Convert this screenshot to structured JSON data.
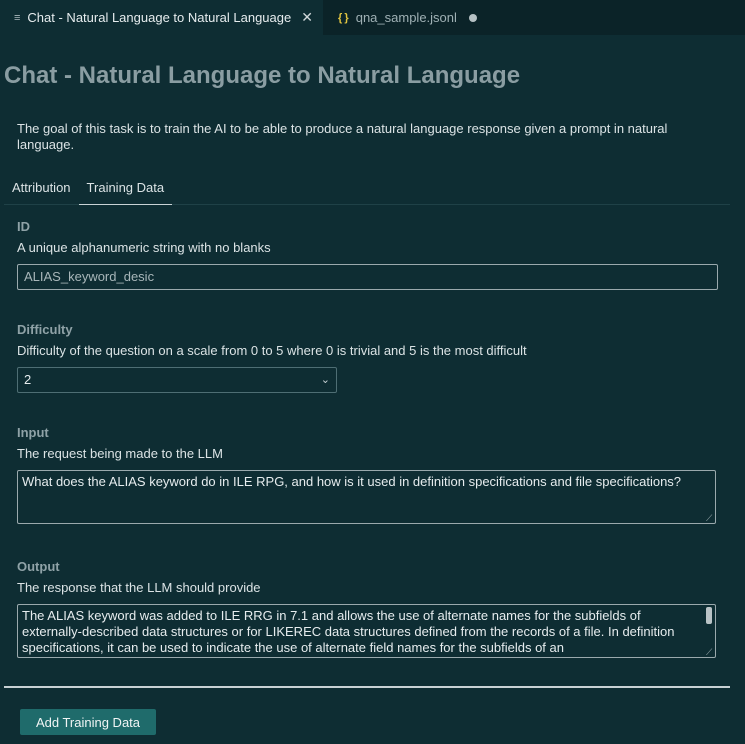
{
  "tabs": [
    {
      "icon": "lines-icon",
      "label": "Chat - Natural Language to Natural Language",
      "active": true
    },
    {
      "icon": "json-braces-icon",
      "label": "qna_sample.jsonl",
      "active": false,
      "modified": true
    }
  ],
  "page": {
    "title": "Chat - Natural Language to Natural Language",
    "description": "The goal of this task is to train the AI to be able to produce a natural language response given a prompt in natural language."
  },
  "subtabs": [
    "Attribution",
    "Training Data"
  ],
  "fields": {
    "id": {
      "title": "ID",
      "description": "A unique alphanumeric string with no blanks",
      "value": "ALIAS_keyword_desic"
    },
    "difficulty": {
      "title": "Difficulty",
      "description": "Difficulty of the question on a scale from 0 to 5 where 0 is trivial and 5 is the most difficult",
      "value": "2"
    },
    "input": {
      "title": "Input",
      "description": "The request being made to the LLM",
      "value": "What does the ALIAS keyword do in ILE RPG, and how is it used in definition specifications and file specifications?"
    },
    "output": {
      "title": "Output",
      "description": "The response that the LLM should provide",
      "value": "The ALIAS keyword was added to  ILE RRG in 7.1 and allows the use of alternate names for the subfields of externally-described data structures or for LIKEREC data structures defined from the records of a file. In definition specifications, it can be used to indicate the use of alternate field names for the subfields of an"
    }
  },
  "actions": {
    "add_label": "Add Training Data"
  },
  "colors": {
    "background": "#0e2d33",
    "accent_button": "#1f6b6b"
  }
}
